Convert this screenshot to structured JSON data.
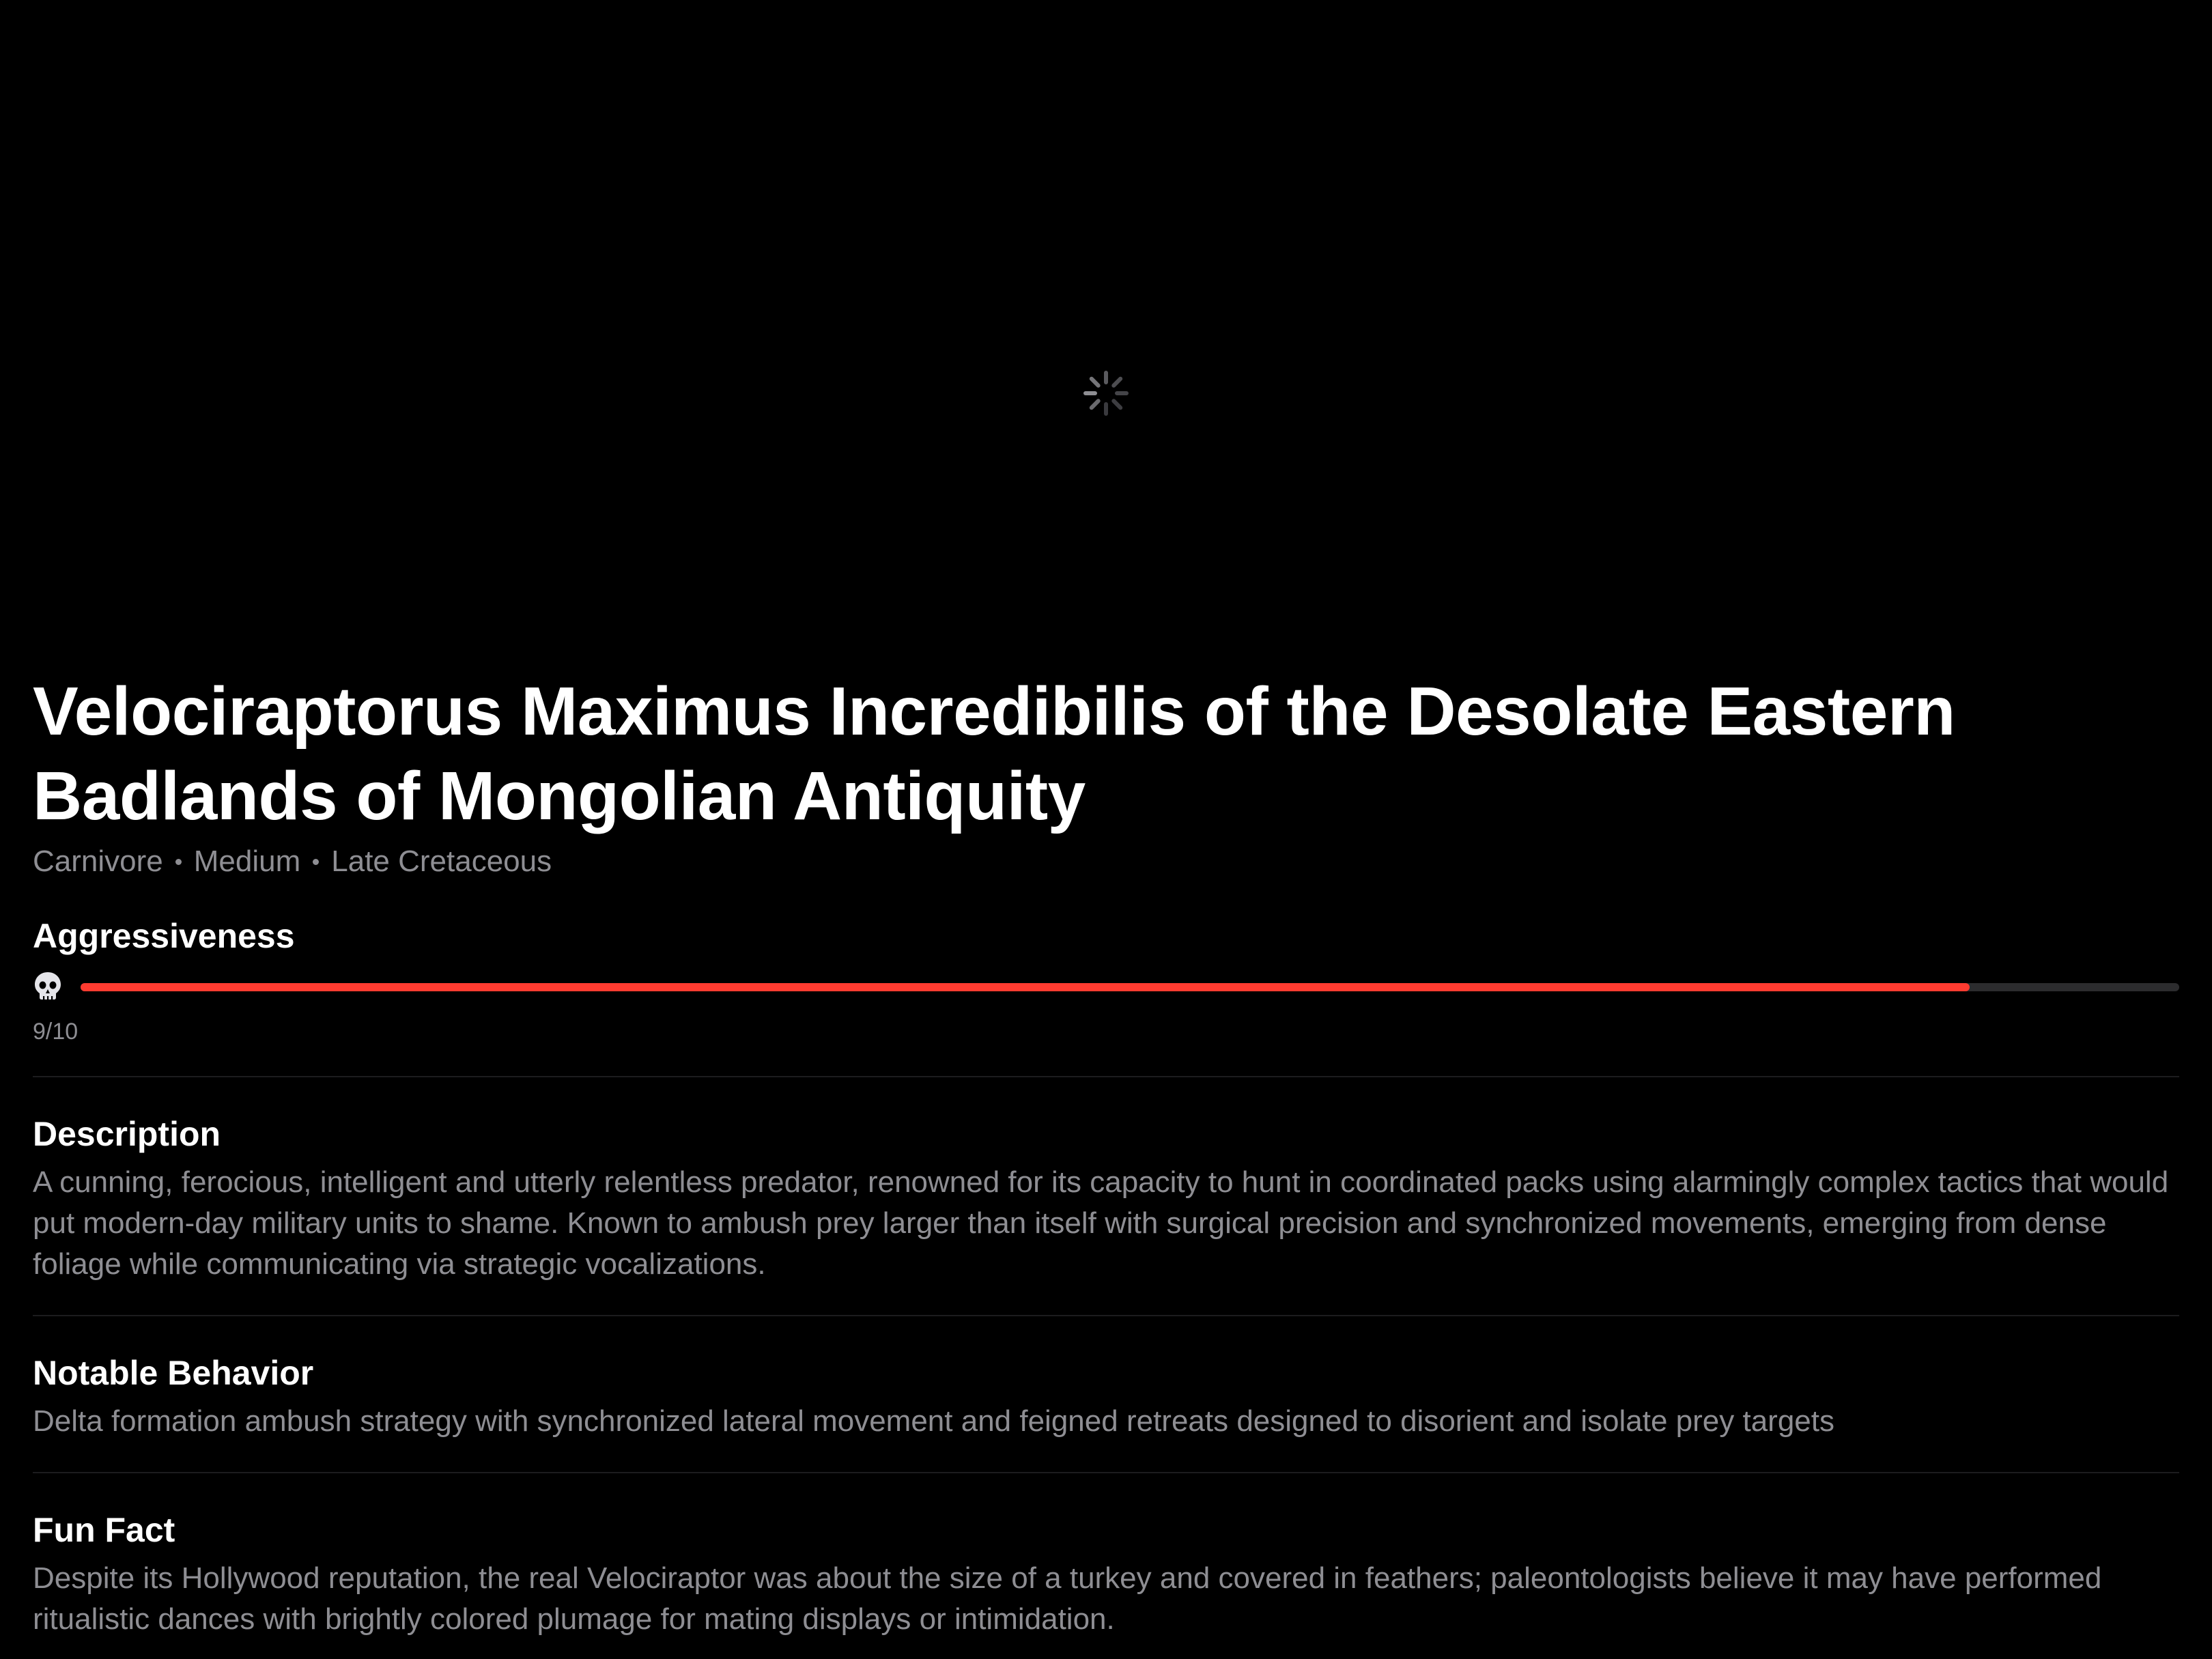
{
  "hero": {
    "loading": true,
    "spinner_icon": "activity-indicator-icon"
  },
  "dinosaur": {
    "name": "Velociraptorus Maximus Incredibilis of the Desolate Eastern Badlands of Mongolian Antiquity",
    "diet": "Carnivore",
    "size": "Medium",
    "period": "Late Cretaceous"
  },
  "aggressiveness": {
    "label": "Aggressiveness",
    "icon": "skull-icon",
    "value": 9,
    "max": 10,
    "score_text": "9/10",
    "bar_color": "#ff3b30"
  },
  "description": {
    "label": "Description",
    "text": "A cunning, ferocious, intelligent and utterly relentless predator, renowned for its capacity to hunt in coordinated packs using alarmingly complex tactics that would put modern-day military units to shame. Known to ambush prey larger than itself with surgical precision and synchronized movements, emerging from dense foliage while communicating via strategic vocalizations."
  },
  "notable_behavior": {
    "label": "Notable Behavior",
    "text": "Delta formation ambush strategy with synchronized lateral movement and feigned retreats designed to disorient and isolate prey targets"
  },
  "fun_fact": {
    "label": "Fun Fact",
    "text": "Despite its Hollywood reputation, the real Velociraptor was about the size of a turkey and covered in feathers; paleontologists believe it may have performed ritualistic dances with brightly colored plumage for mating displays or intimidation."
  }
}
